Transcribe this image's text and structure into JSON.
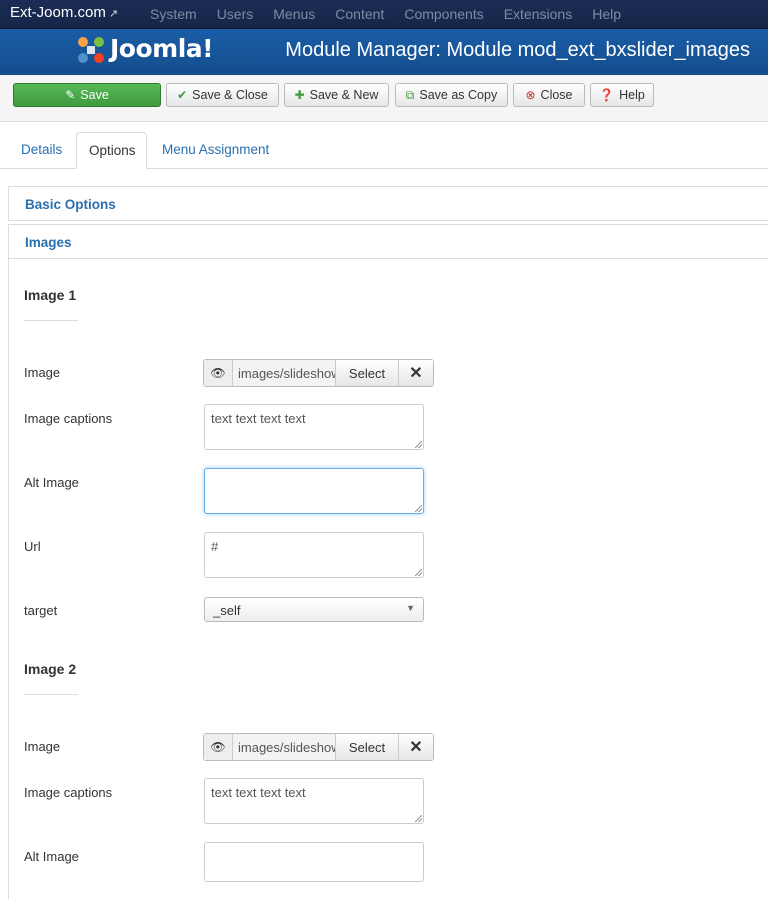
{
  "navbar": {
    "brand": "Ext-Joom.com",
    "brand_icon": "external-link-icon",
    "menu": [
      "System",
      "Users",
      "Menus",
      "Content",
      "Components",
      "Extensions",
      "Help"
    ]
  },
  "header": {
    "logo_text": "Joomla!",
    "title": "Module Manager: Module mod_ext_bxslider_images"
  },
  "toolbar": {
    "save": "Save",
    "save_close": "Save & Close",
    "save_new": "Save & New",
    "save_copy": "Save as Copy",
    "close": "Close",
    "help": "Help"
  },
  "tabs": [
    "Details",
    "Options",
    "Menu Assignment"
  ],
  "accordion": {
    "basic": "Basic Options",
    "images": "Images"
  },
  "image1": {
    "heading": "Image 1",
    "image_label": "Image",
    "image_path": "images/slideshow",
    "select_label": "Select",
    "captions_label": "Image captions",
    "captions_value": "text text text text",
    "alt_label": "Alt Image",
    "alt_value": "",
    "url_label": "Url",
    "url_value": "#",
    "target_label": "target",
    "target_value": "_self"
  },
  "image2": {
    "heading": "Image 2",
    "image_label": "Image",
    "image_path": "images/slideshow",
    "select_label": "Select",
    "captions_label": "Image captions",
    "captions_value": "text text text text",
    "alt_label": "Alt Image",
    "alt_value": ""
  },
  "colors": {
    "header_blue": "#1a5da6",
    "navbar": "#1b2d55",
    "save_green": "#46a546",
    "link_blue": "#2a6fb0"
  }
}
